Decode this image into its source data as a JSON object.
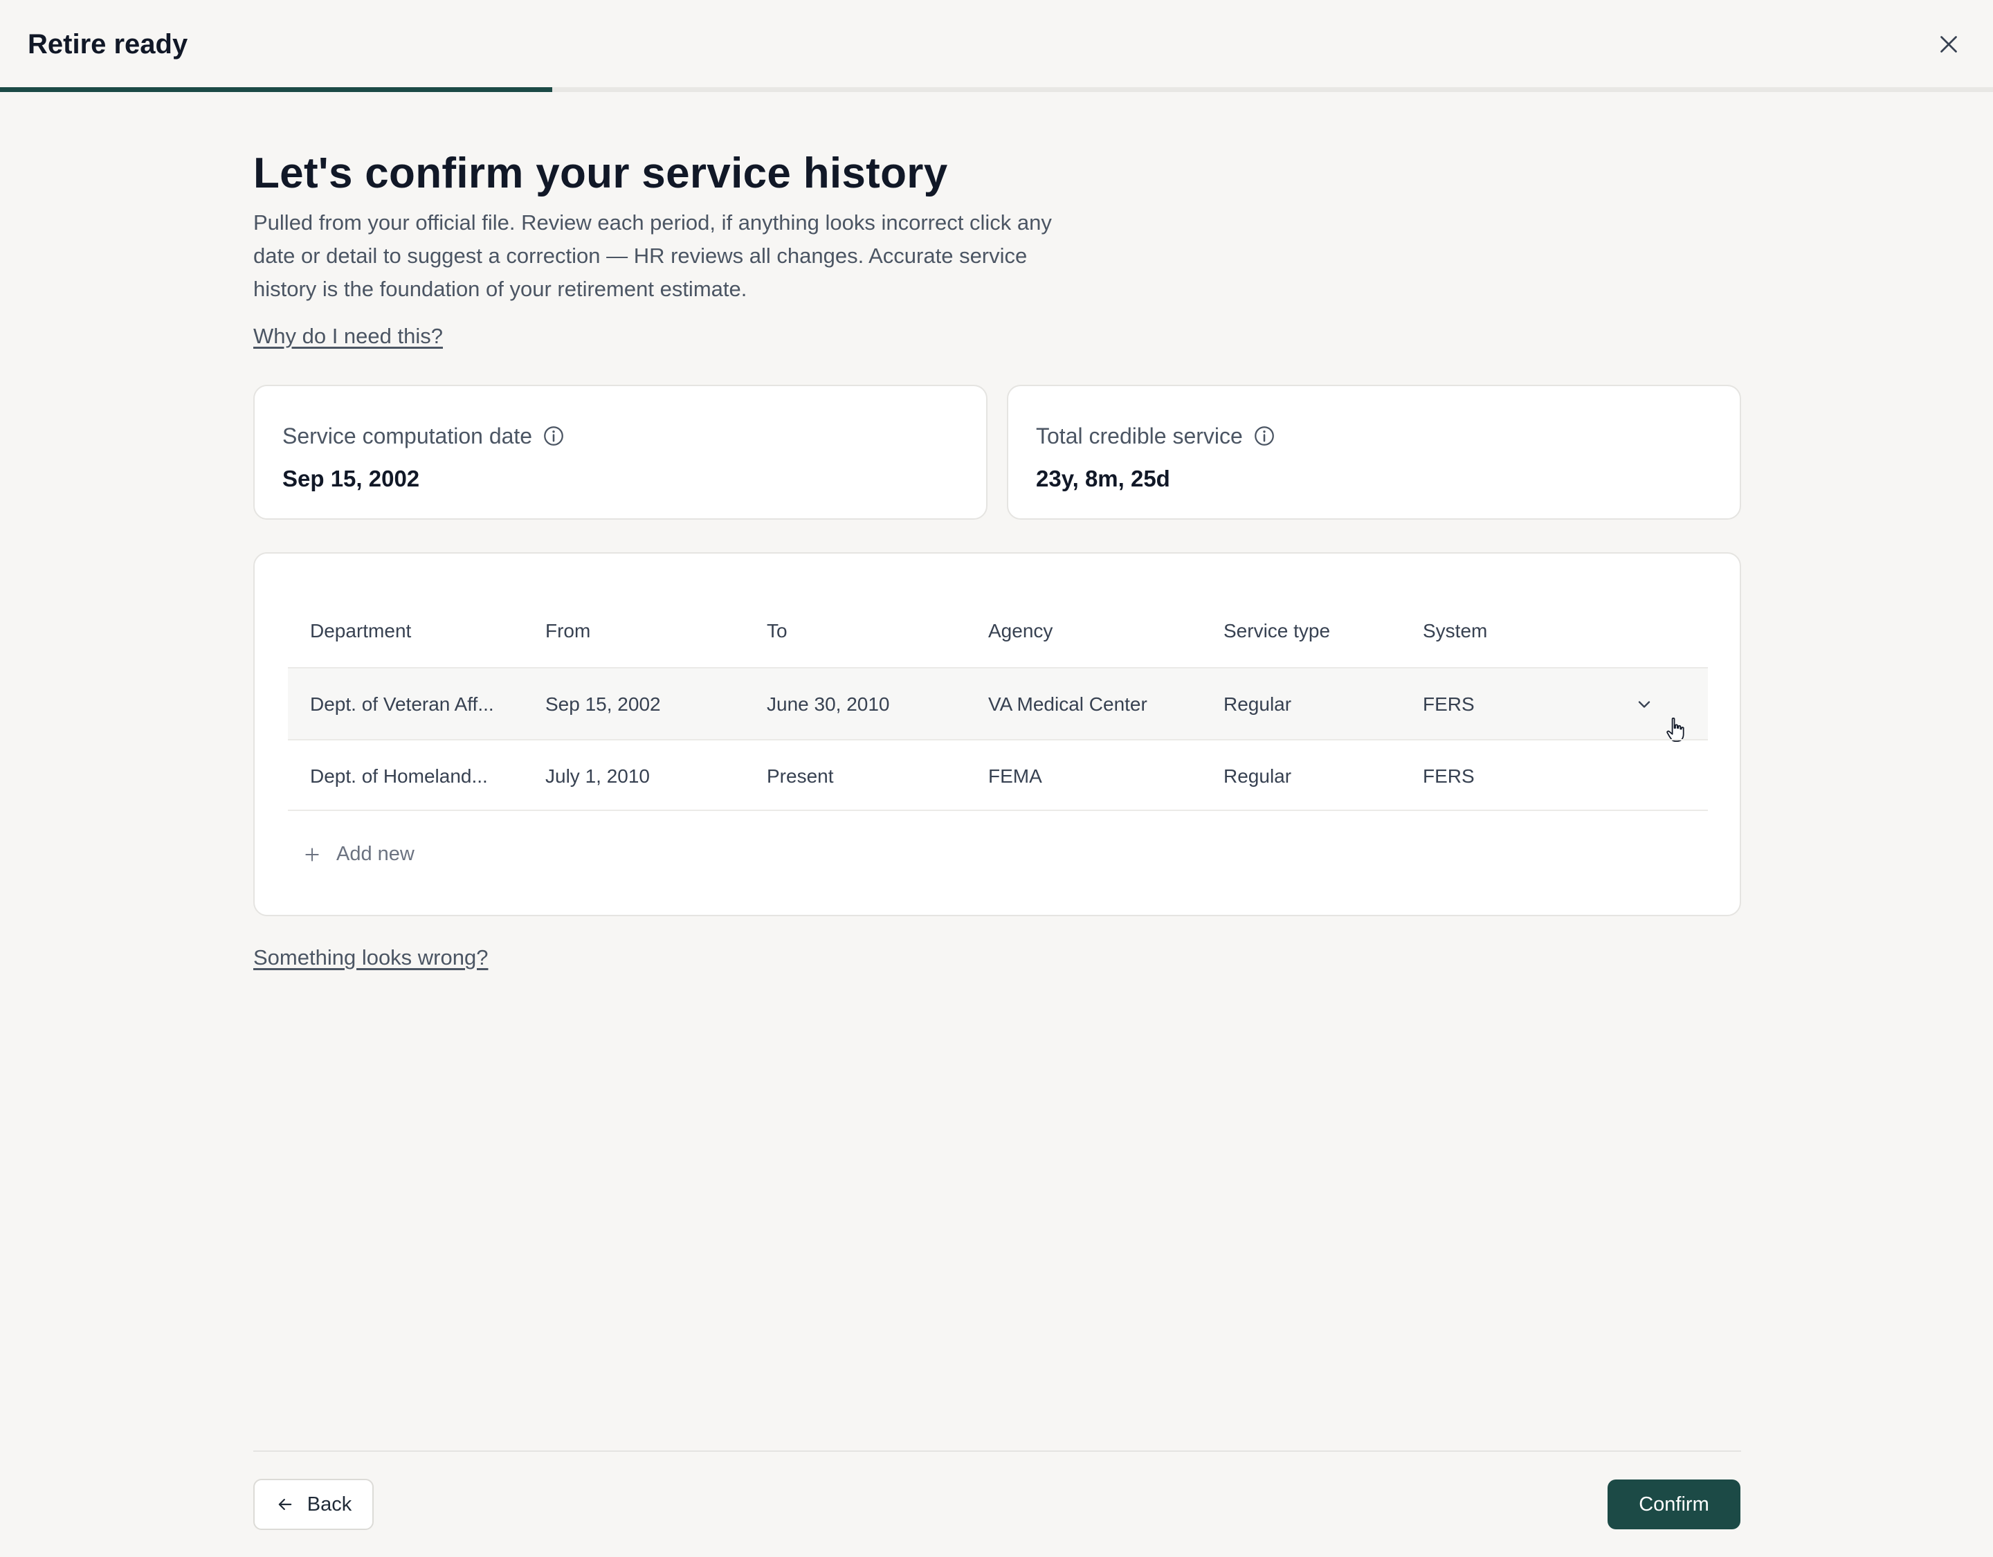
{
  "header": {
    "title": "Retire ready",
    "close_icon": "close-icon",
    "progress_fraction": 0.277
  },
  "main": {
    "heading": "Let's confirm your service history",
    "intro": "Pulled from your official file. Review each period, if anything looks incorrect click any date or detail to suggest a correction — HR reviews all changes. Accurate service history is the foundation of your retirement estimate.",
    "why_link": "Why do I need this?",
    "wrong_link": "Something looks wrong?"
  },
  "cards": [
    {
      "label": "Service computation date",
      "value": "Sep 15, 2002",
      "icon": "info-icon"
    },
    {
      "label": "Total credible service",
      "value": "23y, 8m, 25d",
      "icon": "info-icon"
    }
  ],
  "table": {
    "columns": [
      "Department",
      "From",
      "To",
      "Agency",
      "Service type",
      "System"
    ],
    "rows": [
      {
        "department": "Dept. of Veteran Aff...",
        "from": "Sep 15, 2002",
        "to": "June 30, 2010",
        "agency": "VA Medical Center",
        "service_type": "Regular",
        "system": "FERS"
      },
      {
        "department": "Dept. of Homeland...",
        "from": "July 1, 2010",
        "to": "Present",
        "agency": "FEMA",
        "service_type": "Regular",
        "system": "FERS"
      }
    ],
    "add_new": "Add new"
  },
  "footer": {
    "back_label": "Back",
    "confirm_label": "Confirm"
  },
  "colors": {
    "accent": "#1c4a46",
    "background": "#f7f6f4",
    "card": "#ffffff",
    "border": "#e5e4e1"
  }
}
